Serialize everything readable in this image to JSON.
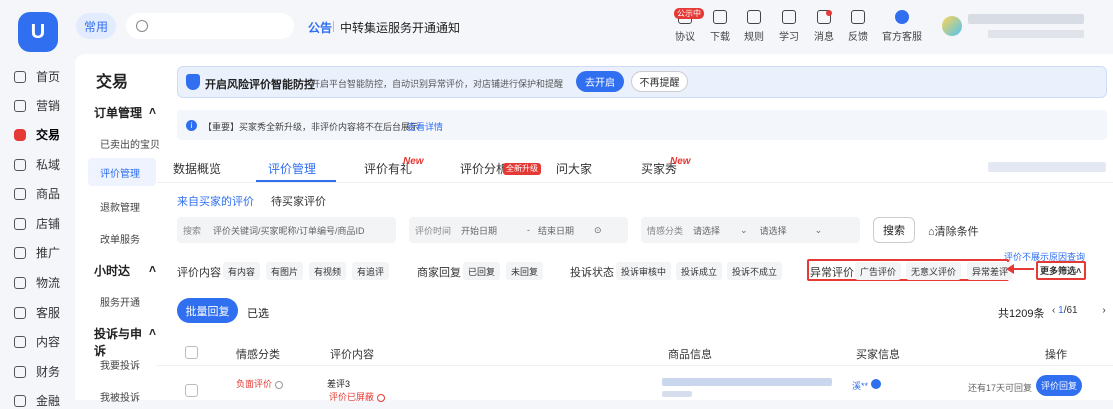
{
  "header": {
    "common_label": "常用",
    "announcement_tag": "公告",
    "announcement_text": "中转集运服务开通通知",
    "tools": [
      {
        "label": "协议",
        "icon": "protocol-icon"
      },
      {
        "label": "下载",
        "icon": "download-icon"
      },
      {
        "label": "规则",
        "icon": "rules-icon"
      },
      {
        "label": "学习",
        "icon": "learn-icon"
      },
      {
        "label": "消息",
        "icon": "message-icon"
      },
      {
        "label": "反馈",
        "icon": "feedback-icon"
      },
      {
        "label": "官方客服",
        "icon": "customer-service-icon"
      }
    ],
    "badge": "公示中"
  },
  "sidebar": {
    "items": [
      {
        "label": "首页",
        "icon": "home-icon"
      },
      {
        "label": "营销",
        "icon": "marketing-icon"
      },
      {
        "label": "交易",
        "icon": "trade-icon"
      },
      {
        "label": "私域",
        "icon": "private-domain-icon"
      },
      {
        "label": "商品",
        "icon": "product-icon"
      },
      {
        "label": "店铺",
        "icon": "store-icon"
      },
      {
        "label": "推广",
        "icon": "promotion-icon"
      },
      {
        "label": "物流",
        "icon": "logistics-icon"
      },
      {
        "label": "客服",
        "icon": "service-icon"
      },
      {
        "label": "内容",
        "icon": "content-icon"
      },
      {
        "label": "财务",
        "icon": "finance-icon"
      },
      {
        "label": "金融",
        "icon": "financial-icon"
      }
    ],
    "active": "交易"
  },
  "subnav": {
    "title": "交易",
    "groups": [
      {
        "label": "订单管理",
        "items": [
          "已卖出的宝贝",
          "评价管理",
          "退款管理",
          "改单服务"
        ]
      },
      {
        "label": "小时达",
        "items": [
          "服务开通"
        ]
      },
      {
        "label": "投诉与申诉",
        "items": [
          "我要投诉",
          "我被投诉"
        ]
      }
    ]
  },
  "banner": {
    "title": "开启风险评价智能防控",
    "desc": "开启平台智能防控，自动识别异常评价，对店铺进行保护和提醒",
    "open_btn": "去开启",
    "no_remind_btn": "不再提醒"
  },
  "notice": {
    "text": "【重要】买家秀全新升级，非评价内容将不在后台展示",
    "link": "查看详情"
  },
  "tabs": [
    {
      "label": "数据概览"
    },
    {
      "label": "评价管理"
    },
    {
      "label": "评价有礼",
      "new": "New"
    },
    {
      "label": "评价分析",
      "tag": "全新升级"
    },
    {
      "label": "问大家"
    },
    {
      "label": "买家秀",
      "new": "New"
    }
  ],
  "subtabs": [
    "来自买家的评价",
    "待买家评价"
  ],
  "filters": {
    "search_label": "搜索",
    "search_placeholder": "评价关键词/买家昵称/订单编号/商品ID",
    "time_label": "评价时间",
    "start_date": "开始日期",
    "date_sep": "-",
    "end_date": "结束日期",
    "sentiment_label": "情感分类",
    "select_placeholder": "请选择",
    "search_btn": "搜索",
    "clear_btn": "清除条件",
    "content_label": "评价内容",
    "content_chips": [
      "有内容",
      "有图片",
      "有视频",
      "有追评"
    ],
    "merchant_reply_label": "商家回复",
    "reply_chips": [
      "已回复",
      "未回复"
    ],
    "complaint_label": "投诉状态",
    "complaint_chips": [
      "投诉审核中",
      "投诉成立",
      "投诉不成立"
    ],
    "abnormal_label": "异常评价",
    "abnormal_chips": [
      "广告评价",
      "无意义评价",
      "异常差评"
    ],
    "more_filter": "更多筛选",
    "reason_link": "评价不展示原因查询"
  },
  "list": {
    "batch_btn": "批量回复",
    "selected_label": "已选",
    "total": "共1209条",
    "page_current": "1",
    "page_total": "/61",
    "columns": [
      "情感分类",
      "评价内容",
      "商品信息",
      "买家信息",
      "操作"
    ],
    "rows": [
      {
        "sentiment": "负面评价",
        "content": "差评3",
        "status": "评价已屏蔽",
        "buyer": "溪**",
        "remain": "还有17天可回复",
        "action": "评价回复"
      }
    ]
  }
}
